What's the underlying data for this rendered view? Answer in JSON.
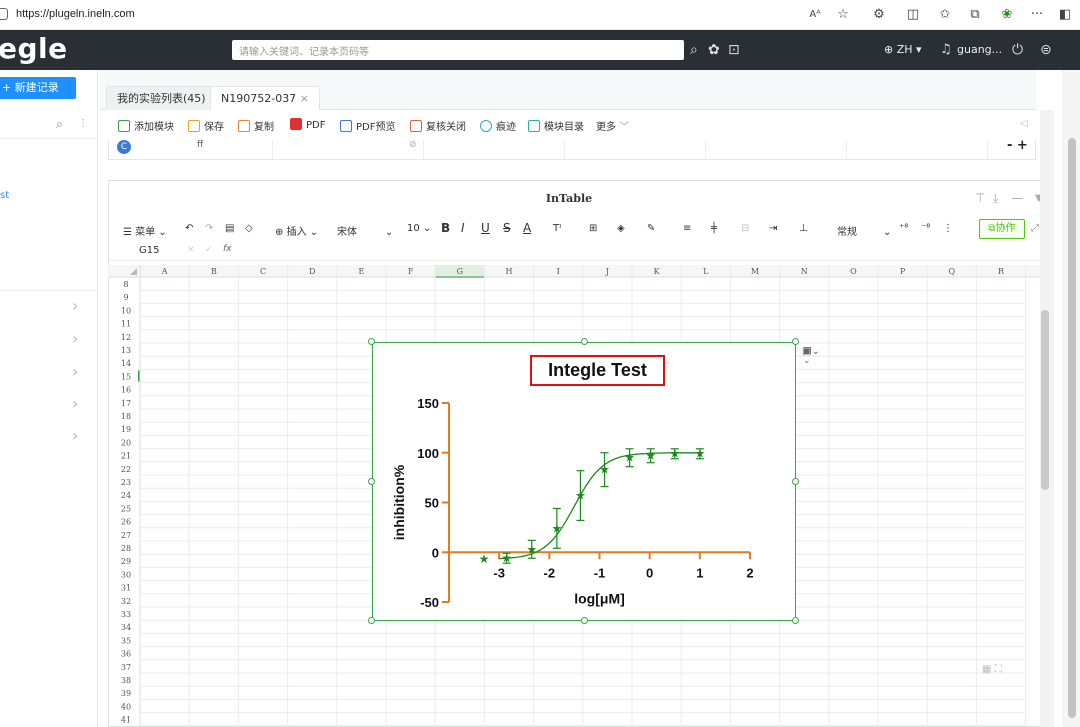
{
  "browser": {
    "url": "https://plugeln.ineln.com",
    "reader_icon": "Aᴬ"
  },
  "header": {
    "logo": "egle",
    "search_placeholder": "请输入关键词、记录本页码等",
    "lang": "ZH",
    "user": "guang..."
  },
  "sidebar": {
    "new_record": "新建记录",
    "item_text": "st"
  },
  "tabs": [
    {
      "label": "我的实验列表(45)"
    },
    {
      "label": "N190752-037"
    }
  ],
  "tab_close": "×",
  "toolbar": {
    "add_module": "添加模块",
    "save": "保存",
    "copy": "复制",
    "pdf": "PDF",
    "pdf_preview": "PDF预览",
    "review_close": "复核关闭",
    "trace": "痕迹",
    "module_dir": "模块目录",
    "more": "更多"
  },
  "row_strip": {
    "badge": "C",
    "cell": "ff",
    "controls": "- +"
  },
  "intable": {
    "title": "InTable",
    "menu": "菜单",
    "insert": "插入",
    "font": "宋体",
    "font_size": "10",
    "number_format": "常规",
    "collab": "协作",
    "cell_ref": "G15",
    "fx": "fx"
  },
  "sheet": {
    "columns": [
      "A",
      "B",
      "C",
      "D",
      "E",
      "F",
      "G",
      "H",
      "I",
      "J",
      "K",
      "L",
      "M",
      "N",
      "O",
      "P",
      "Q",
      "R"
    ],
    "rows": [
      "8",
      "9",
      "10",
      "11",
      "12",
      "13",
      "14",
      "15",
      "16",
      "17",
      "18",
      "19",
      "20",
      "21",
      "22",
      "23",
      "24",
      "25",
      "26",
      "27",
      "28",
      "29",
      "30",
      "31",
      "32",
      "33",
      "34",
      "35",
      "36",
      "37",
      "38",
      "39",
      "40",
      "41"
    ],
    "selected_column": "G",
    "selected_row": "15"
  },
  "chart_data": {
    "type": "scatter",
    "title": "Integle Test",
    "xlabel": "log[μM]",
    "ylabel": "inhibition%",
    "xlim": [
      -4,
      2
    ],
    "ylim": [
      -50,
      150
    ],
    "xticks": [
      "-3",
      "-2",
      "-1",
      "0",
      "1",
      "2"
    ],
    "yticks": [
      "-50",
      "0",
      "50",
      "100",
      "150"
    ],
    "points": [
      {
        "x": -3.3,
        "y": -7,
        "err": 0
      },
      {
        "x": -2.85,
        "y": -6,
        "err": 5
      },
      {
        "x": -2.35,
        "y": 3,
        "err": 9
      },
      {
        "x": -1.85,
        "y": 24,
        "err": 20
      },
      {
        "x": -1.38,
        "y": 57,
        "err": 25
      },
      {
        "x": -0.9,
        "y": 83,
        "err": 17
      },
      {
        "x": -0.4,
        "y": 95,
        "err": 9
      },
      {
        "x": 0.02,
        "y": 97,
        "err": 7
      },
      {
        "x": 0.5,
        "y": 99,
        "err": 5
      },
      {
        "x": 1.0,
        "y": 99,
        "err": 5
      }
    ],
    "fit": {
      "bottom": -7,
      "top": 100,
      "logEC50": -1.5,
      "hill": 1.5
    },
    "colors": {
      "points": "#1a8a1a",
      "axes": "#e87a1e",
      "title_box": "#d11",
      "frame": "#3aa64a"
    }
  }
}
